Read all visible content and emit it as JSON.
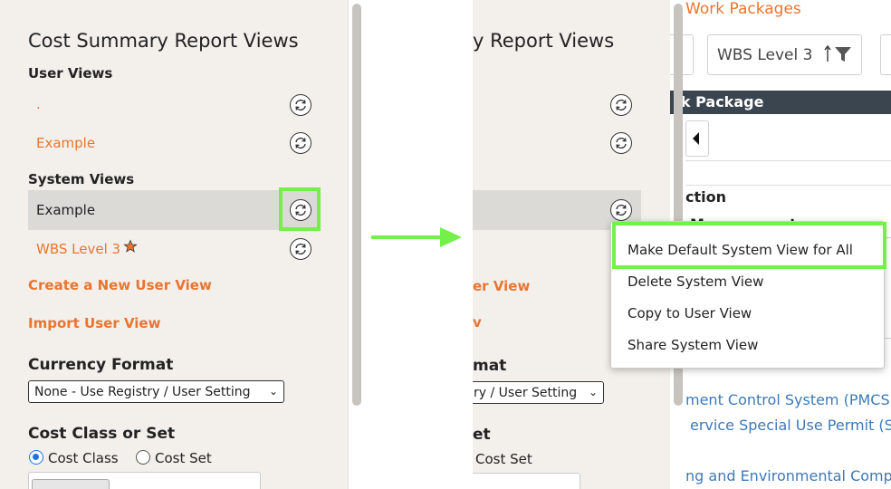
{
  "left_panel": {
    "title": "Cost Summary Report Views",
    "user_views_heading": "User Views",
    "user_views": [
      {
        "label": "."
      },
      {
        "label": "Example"
      }
    ],
    "system_views_heading": "System Views",
    "system_views": [
      {
        "label": "Example",
        "selected": true
      },
      {
        "label": "WBS Level 3",
        "default": true
      }
    ],
    "create_link": "Create a New User View",
    "import_link": "Import User View",
    "currency_heading": "Currency Format",
    "currency_value": "None - Use Registry / User Setting",
    "cost_class_heading": "Cost Class or Set",
    "radio_cost_class": "Cost Class",
    "radio_cost_set": "Cost Set"
  },
  "right_panel": {
    "title_partial": "y Report Views",
    "create_link_partial": "er View",
    "import_link_partial": "v",
    "currency_heading_partial": "mat",
    "currency_value_partial": "ry / User Setting",
    "cost_class_heading_partial": "et",
    "radio_cost_set": "Cost Set"
  },
  "background_page": {
    "header": "Work Packages",
    "filter_value": "WBS Level 3",
    "table_header": "rk Package",
    "section_label": "ction",
    "row_partial": "Management",
    "links": [
      "ment Control System (PMCS",
      "ervice Special Use Permit (SU",
      "ng and Environmental Comp"
    ]
  },
  "context_menu": {
    "items": [
      "Make Default System View for All",
      "Delete System View",
      "Copy to User View",
      "Share System View"
    ]
  },
  "colors": {
    "accent": "#e87530",
    "highlight": "#74f04a",
    "panel_bg": "#f3f0eb",
    "link_blue": "#3d79b8",
    "header_dark": "#3a4550"
  }
}
